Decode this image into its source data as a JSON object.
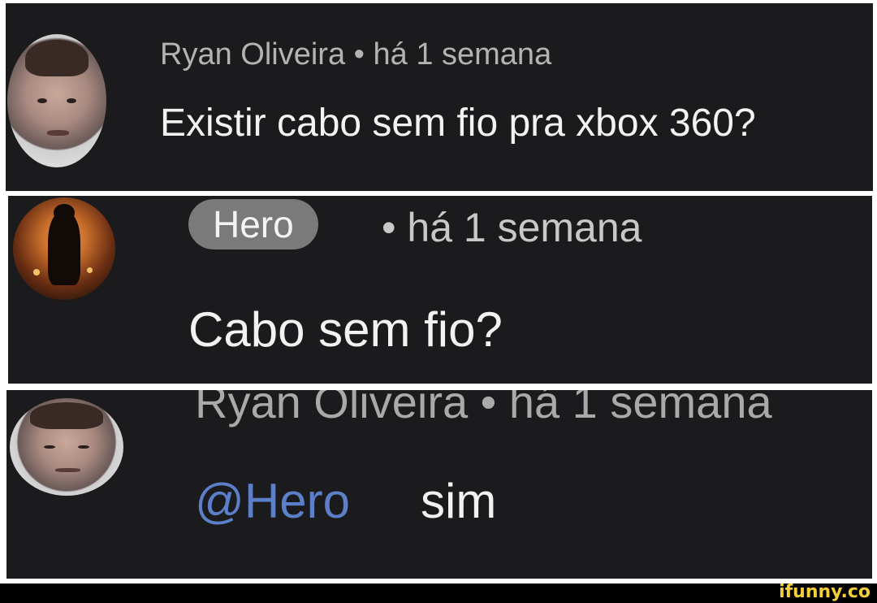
{
  "comments": [
    {
      "author": "Ryan Oliveira",
      "meta": "Ryan Oliveira • há 1 semana",
      "text": "Existir cabo sem fio pra xbox 360?"
    },
    {
      "author_badge": "Hero",
      "meta": "• há 1 semana",
      "text": "Cabo sem fio?"
    },
    {
      "meta": "Ryan Oliveira • há 1 semana",
      "mention": "@Hero",
      "text": "sim"
    }
  ],
  "watermark": "ifunny.co",
  "colors": {
    "panel_bg": "#1b1b1d",
    "mention": "#5b7fc8",
    "badge_bg": "#7a7a7a",
    "watermark": "#f2cf3a"
  }
}
